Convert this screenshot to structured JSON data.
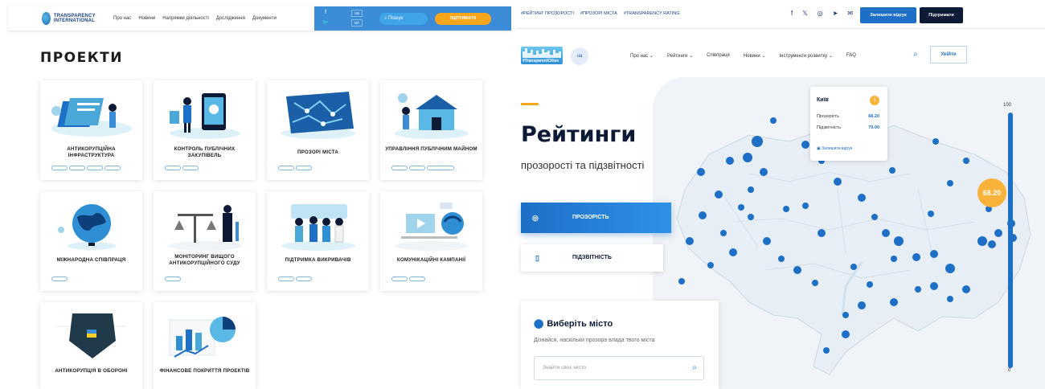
{
  "left": {
    "logo_text": "TRANSPARENCY INTERNATIONAL",
    "nav": [
      "Про нас",
      "Новини",
      "Напрямки діяльності",
      "Дослідження",
      "Документи"
    ],
    "lang": [
      "ua",
      "en"
    ],
    "search_label": "Пошук",
    "support_label": "ПІДТРИМАТИ",
    "title": "ПРОЕКТИ",
    "projects": [
      {
        "title": "АНТИКОРУПЦІЙНА ІНФРАСТРУКТУРА",
        "icon": "infrastructure-illustration"
      },
      {
        "title": "КОНТРОЛЬ ПУБЛІЧНИХ ЗАКУПІВЕЛЬ",
        "icon": "procurement-illustration"
      },
      {
        "title": "ПРОЗОРІ МІСТА",
        "icon": "city-map-illustration"
      },
      {
        "title": "УПРАВЛІННЯ ПУБЛІЧНИМ МАЙНОМ",
        "icon": "property-illustration"
      },
      {
        "title": "МІЖНАРОДНА СПІВПРАЦЯ",
        "icon": "globe-illustration"
      },
      {
        "title": "МОНІТОРИНГ ВИЩОГО АНТИКОРУПЦІЙНОГО СУДУ",
        "icon": "court-scales-illustration"
      },
      {
        "title": "ПІДТРИМКА ВИКРИВАЧІВ",
        "icon": "whistleblower-illustration"
      },
      {
        "title": "КОМУНІКАЦІЙНІ КАМПАНІЇ",
        "icon": "campaign-illustration"
      },
      {
        "title": "АНТИКОРУПЦІЯ В ОБОРОНІ",
        "icon": "defense-shield-illustration"
      },
      {
        "title": "ФІНАНСОВЕ ПОКРИТТЯ ПРОЕКТІВ",
        "icon": "finance-chart-illustration"
      }
    ]
  },
  "right": {
    "hashtags": [
      "#РЕЙТИНГ ПРОЗОРОСТІ",
      "#ПРОЗОРІ МІСТА",
      "#TRANSPARENCY RATING"
    ],
    "leave_review": "Залишити відгук",
    "support": "Підтримати",
    "logo_text": "#TransparentCities",
    "lang": "ua",
    "nav": [
      "Про нас ⌄",
      "Рейтинги ⌄",
      "Співпраця",
      "Новини ⌄",
      "Інструменти розвитку ⌄",
      "FAQ"
    ],
    "login": "Увійти",
    "heading": "Рейтинги",
    "subheading": "прозорості та підзвітності",
    "btn_transparency": "ПРОЗОРІСТЬ",
    "btn_accountability": "ПІДЗВІТНІСТЬ",
    "city_box": {
      "title": "Виберіть місто",
      "desc": "Дізнайся, наскільки прозора влада твого міста",
      "placeholder": "Знайти своє місто"
    },
    "tooltip": {
      "city": "Київ",
      "badge": "1",
      "rows": [
        {
          "label": "Прозорість",
          "value": "68.20"
        },
        {
          "label": "Підзвітність",
          "value": "79.00"
        }
      ],
      "review": "Залишити відгук"
    },
    "slider": {
      "max": "100",
      "min": "0",
      "value": "68.20"
    },
    "colors": {
      "primary": "#1e6fc6",
      "accent": "#f9a61a",
      "dark": "#0d1a35"
    }
  }
}
